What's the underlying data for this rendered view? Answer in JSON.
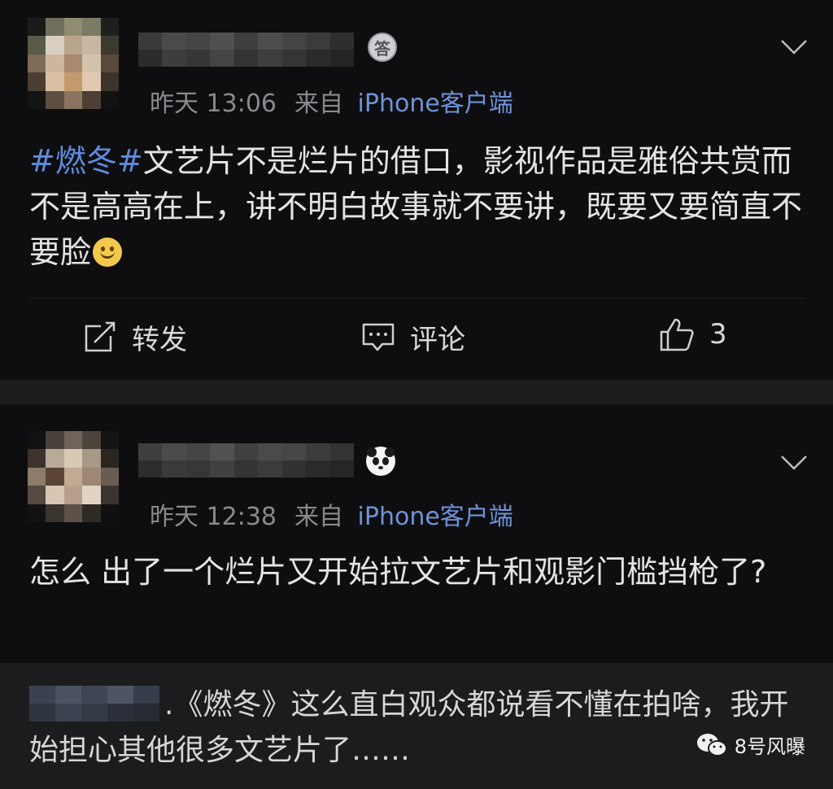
{
  "posts": [
    {
      "time": "昨天 13:06",
      "source_prefix": "来自",
      "source": "iPhone客户端",
      "badge_text": "答",
      "badge": "medal-icon",
      "hashtag": "#燃冬#",
      "body": "文艺片不是烂片的借口，影视作品是雅俗共赏而不是高高在上，讲不明白故事就不要讲，既要又要简直不要脸",
      "emoji": "smile-emoji",
      "actions": {
        "repost": "转发",
        "comment": "评论",
        "like_count": "3"
      }
    },
    {
      "time": "昨天 12:38",
      "source_prefix": "来自",
      "source": "iPhone客户端",
      "badge": "panda-icon",
      "body": "怎么 出了一个烂片又开始拉文艺片和观影门槛挡枪了?"
    }
  ],
  "quote": {
    "text": ".《燃冬》这么直白观众都说看不懂在拍啥，我开始担心其他很多文艺片了……"
  },
  "watermark": {
    "text": "8号风曝",
    "icon": "wechat-icon"
  },
  "colors": {
    "background": "#0e0e10",
    "link": "#5e8cdc",
    "meta": "#8a8a8e"
  }
}
